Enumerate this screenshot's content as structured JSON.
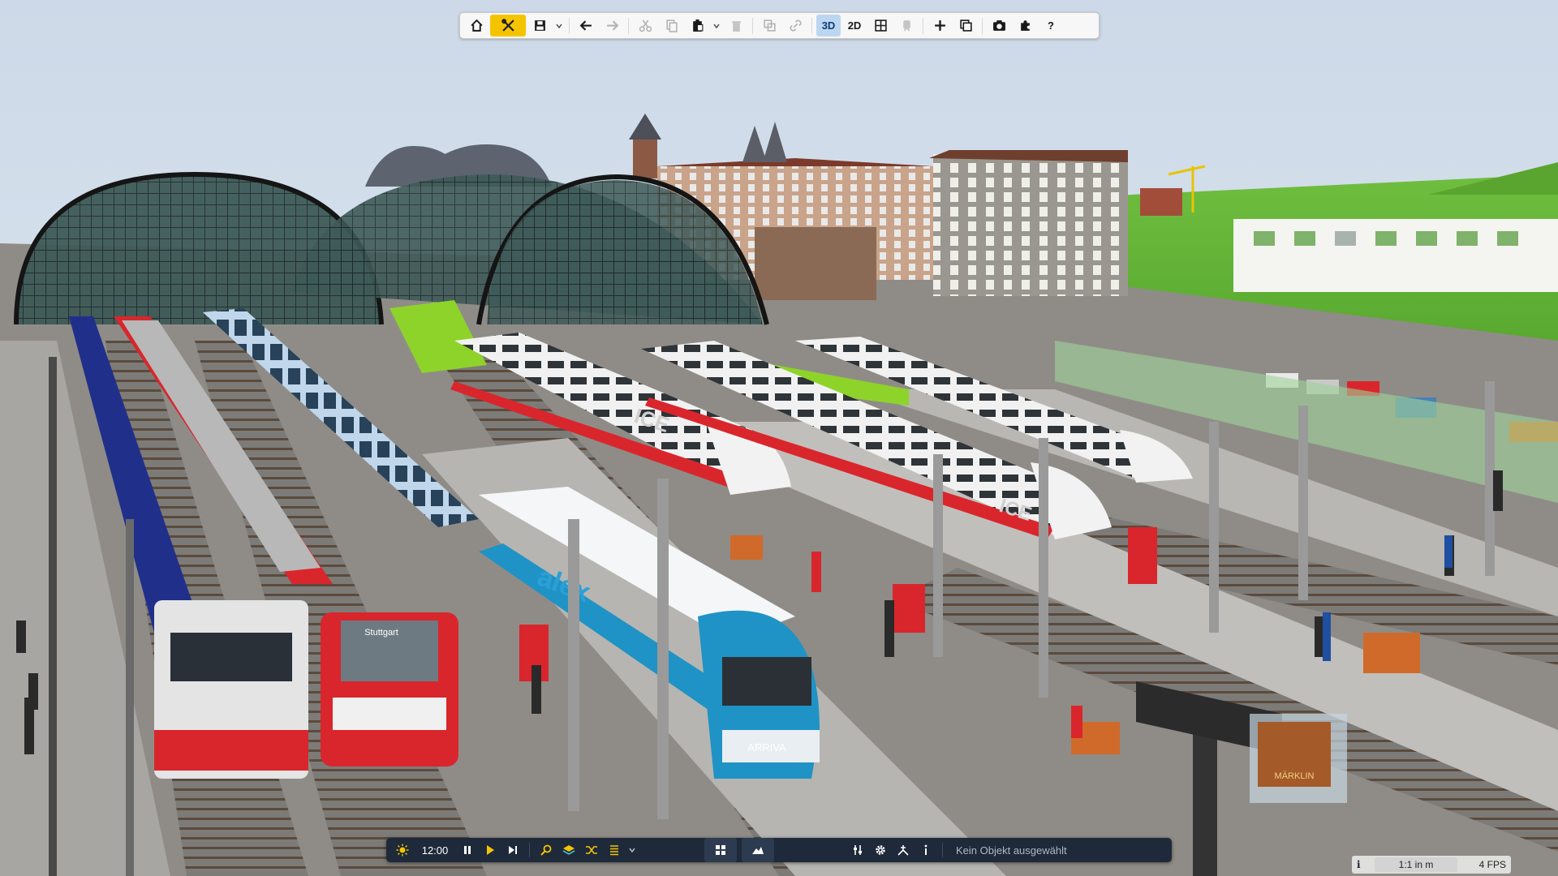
{
  "colors": {
    "sky": "#d9e5f2",
    "toolbar_active": "#f5c400",
    "toolbar_3d_active": "#bcd6f2",
    "bottom_bar": "#1e2a3a",
    "alex_blue": "#1f93c5",
    "db_red": "#d9262c",
    "ice_white": "#f2f2f2",
    "flix_green": "#8ed32a"
  },
  "top_toolbar": {
    "buttons": [
      {
        "name": "home",
        "icon": "home-icon"
      },
      {
        "name": "tools",
        "icon": "tools-icon",
        "active": true
      },
      {
        "name": "save",
        "icon": "save-icon"
      },
      {
        "name": "undo",
        "icon": "undo-icon"
      },
      {
        "name": "redo",
        "icon": "redo-icon",
        "disabled": true
      },
      {
        "name": "cut",
        "icon": "cut-icon",
        "disabled": true
      },
      {
        "name": "copy",
        "icon": "copy-icon",
        "disabled": true
      },
      {
        "name": "paste",
        "icon": "paste-icon"
      },
      {
        "name": "delete",
        "icon": "trash-icon",
        "disabled": true
      },
      {
        "name": "duplicate",
        "icon": "duplicate-icon",
        "disabled": true
      },
      {
        "name": "link",
        "icon": "link-icon",
        "disabled": true
      },
      {
        "name": "grid",
        "icon": "grid-icon"
      },
      {
        "name": "train",
        "icon": "train-icon",
        "disabled": true
      },
      {
        "name": "add",
        "icon": "plus-icon"
      },
      {
        "name": "window",
        "icon": "window-icon"
      },
      {
        "name": "camera",
        "icon": "camera-icon"
      },
      {
        "name": "plugin",
        "icon": "puzzle-icon"
      },
      {
        "name": "help",
        "icon": "help-icon"
      }
    ],
    "view_3d_label": "3D",
    "view_2d_label": "2D",
    "help_label": "?"
  },
  "bottom_toolbar": {
    "time": "12:00",
    "status": "Kein Objekt ausgewählt",
    "icons": [
      "sun-icon",
      "pause-icon",
      "play-icon",
      "step-icon",
      "search-icon",
      "layers-icon",
      "shuffle-icon",
      "list-icon",
      "chevron-down-icon",
      "tiles-icon",
      "terrain-icon",
      "sliders-icon",
      "gear-icon",
      "tracks-icon",
      "info-icon"
    ]
  },
  "info_strip": {
    "info": "i",
    "scale": "1:1 in m",
    "fps": "4 FPS"
  },
  "scene": {
    "train_labels": [
      "alex",
      "ARRIVA",
      "ICE",
      "ICE",
      "Stuttgart"
    ],
    "poster": "MÄRKLIN"
  }
}
